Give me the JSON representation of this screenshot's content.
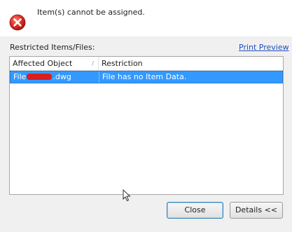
{
  "dialog": {
    "message": "Item(s) cannot be assigned.",
    "icon": "error-icon",
    "error_color": "#d91f1f"
  },
  "section": {
    "label": "Restricted Items/Files:",
    "print_preview": "Print Preview"
  },
  "table": {
    "columns": [
      "Affected Object",
      "Restriction"
    ],
    "rows": [
      {
        "affected_prefix": "File",
        "affected_suffix": ".dwg",
        "restriction": "File has no Item Data.",
        "selected": true
      }
    ]
  },
  "buttons": {
    "close": "Close",
    "details": "Details <<"
  },
  "colors": {
    "selection": "#3399ff",
    "link": "#1f4fbf"
  }
}
